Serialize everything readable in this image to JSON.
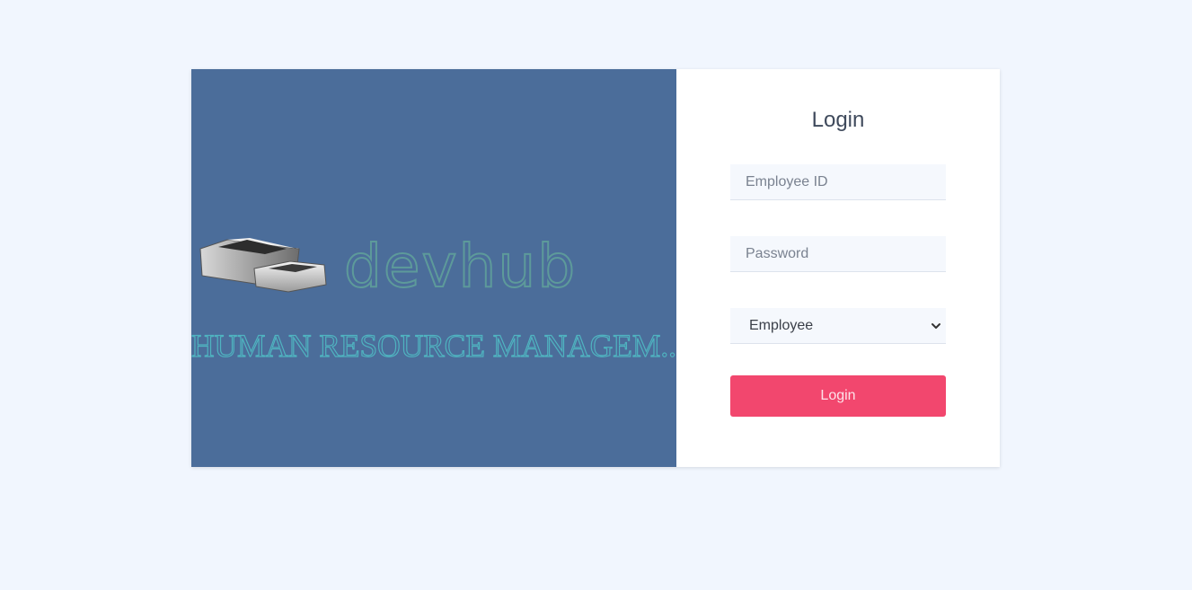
{
  "brand": {
    "logo_text": "devhub",
    "tagline": "HUMAN RESOURCE MANAGEM..",
    "panel_color": "#4b6d9a"
  },
  "login": {
    "title": "Login",
    "employee_id_placeholder": "Employee ID",
    "password_placeholder": "Password",
    "role_selected": "Employee",
    "submit_label": "Login",
    "accent_color": "#f2476e"
  }
}
